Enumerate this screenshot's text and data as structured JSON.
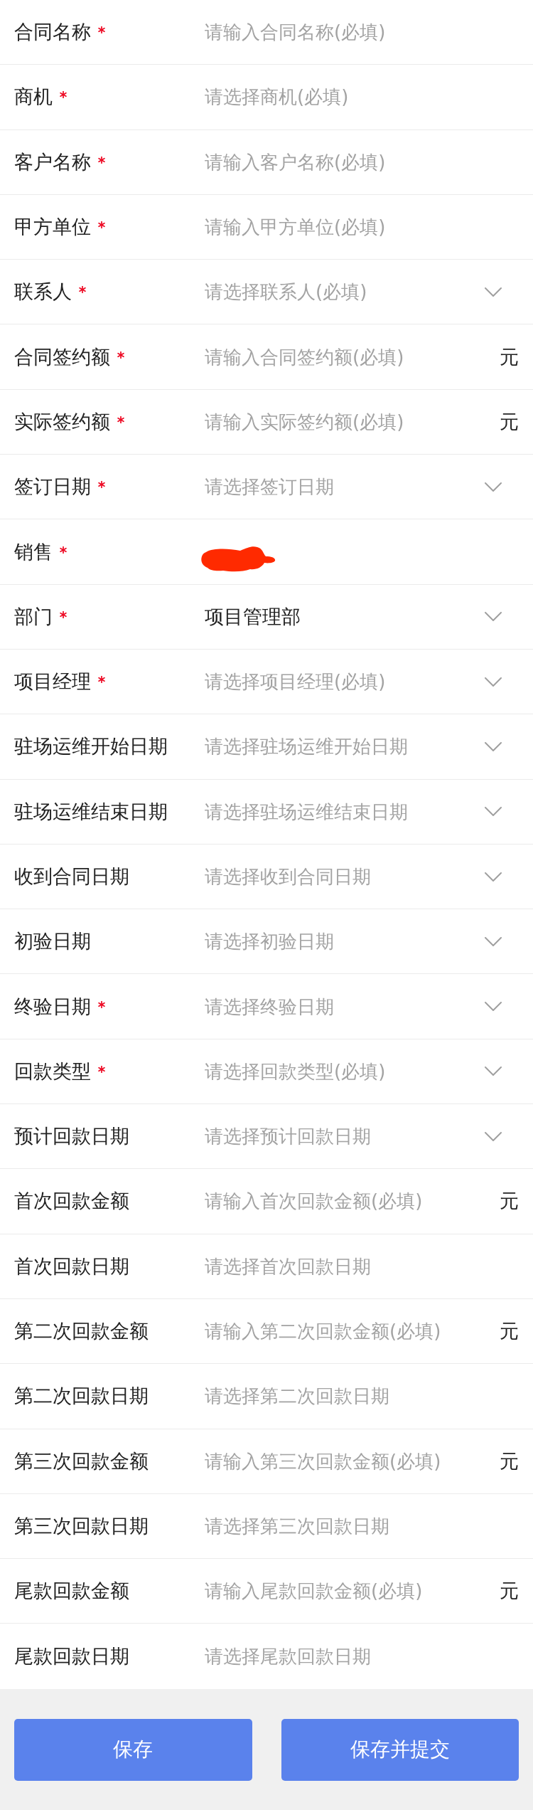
{
  "fields": [
    {
      "label": "合同名称",
      "required": true,
      "kind": "text",
      "placeholder": "请输入合同名称(必填)"
    },
    {
      "label": "商机",
      "required": true,
      "kind": "text",
      "placeholder": "请选择商机(必填)"
    },
    {
      "label": "客户名称",
      "required": true,
      "kind": "text",
      "placeholder": "请输入客户名称(必填)"
    },
    {
      "label": "甲方单位",
      "required": true,
      "kind": "text",
      "placeholder": "请输入甲方单位(必填)"
    },
    {
      "label": "联系人",
      "required": true,
      "kind": "select",
      "placeholder": "请选择联系人(必填)"
    },
    {
      "label": "合同签约额",
      "required": true,
      "kind": "amount",
      "placeholder": "请输入合同签约额(必填)",
      "unit": "元"
    },
    {
      "label": "实际签约额",
      "required": true,
      "kind": "amount",
      "placeholder": "请输入实际签约额(必填)",
      "unit": "元"
    },
    {
      "label": "签订日期",
      "required": true,
      "kind": "select",
      "placeholder": "请选择签订日期"
    },
    {
      "label": "销售",
      "required": true,
      "kind": "redacted"
    },
    {
      "label": "部门",
      "required": true,
      "kind": "select",
      "value": "项目管理部"
    },
    {
      "label": "项目经理",
      "required": true,
      "kind": "select",
      "placeholder": "请选择项目经理(必填)"
    },
    {
      "label": "驻场运维开始日期",
      "required": false,
      "kind": "select",
      "placeholder": "请选择驻场运维开始日期"
    },
    {
      "label": "驻场运维结束日期",
      "required": false,
      "kind": "select",
      "placeholder": "请选择驻场运维结束日期"
    },
    {
      "label": "收到合同日期",
      "required": false,
      "kind": "select",
      "placeholder": "请选择收到合同日期"
    },
    {
      "label": "初验日期",
      "required": false,
      "kind": "select",
      "placeholder": "请选择初验日期"
    },
    {
      "label": "终验日期",
      "required": true,
      "kind": "select",
      "placeholder": "请选择终验日期"
    },
    {
      "label": "回款类型",
      "required": true,
      "kind": "select",
      "placeholder": "请选择回款类型(必填)"
    },
    {
      "label": "预计回款日期",
      "required": false,
      "kind": "select",
      "placeholder": "请选择预计回款日期"
    },
    {
      "label": "首次回款金额",
      "required": false,
      "kind": "amount",
      "placeholder": "请输入首次回款金额(必填)",
      "unit": "元"
    },
    {
      "label": "首次回款日期",
      "required": false,
      "kind": "text",
      "placeholder": "请选择首次回款日期"
    },
    {
      "label": "第二次回款金额",
      "required": false,
      "kind": "amount",
      "placeholder": "请输入第二次回款金额(必填)",
      "unit": "元"
    },
    {
      "label": "第二次回款日期",
      "required": false,
      "kind": "text",
      "placeholder": "请选择第二次回款日期"
    },
    {
      "label": "第三次回款金额",
      "required": false,
      "kind": "amount",
      "placeholder": "请输入第三次回款金额(必填)",
      "unit": "元"
    },
    {
      "label": "第三次回款日期",
      "required": false,
      "kind": "text",
      "placeholder": "请选择第三次回款日期"
    },
    {
      "label": "尾款回款金额",
      "required": false,
      "kind": "amount",
      "placeholder": "请输入尾款回款金额(必填)",
      "unit": "元"
    },
    {
      "label": "尾款回款日期",
      "required": false,
      "kind": "text",
      "placeholder": "请选择尾款回款日期"
    }
  ],
  "buttons": [
    {
      "label": "保存"
    },
    {
      "label": "保存并提交"
    }
  ]
}
